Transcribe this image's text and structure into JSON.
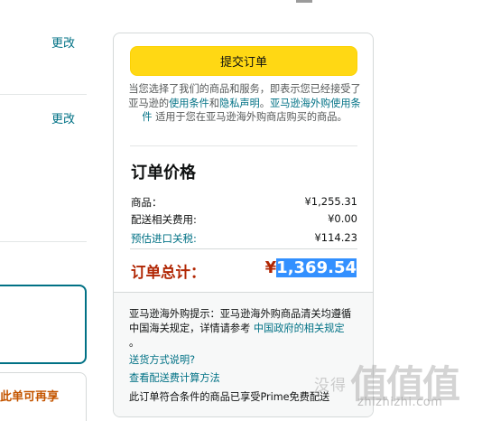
{
  "left": {
    "change_link_1": "更改",
    "change_link_2": "更改",
    "promo_text": "此单可再享"
  },
  "summary": {
    "place_order_button": "提交订单",
    "agreement": {
      "part1": "当您选择了我们的商品和服务，即表示您已经接受了亚马逊的",
      "link1": "使用条件",
      "and": "和",
      "link2": "隐私声明",
      "dot": "。",
      "link3": "亚马逊海外购使用条件",
      "part2": " 适用于您在亚马逊海外购商店购买的商品。"
    },
    "title": "订单价格",
    "rows": [
      {
        "label": "商品：",
        "value": "¥1,255.31"
      },
      {
        "label": "配送相关费用:",
        "value": "¥0.00"
      },
      {
        "label": "预估进口关税:",
        "value": "¥114.23"
      }
    ],
    "total_label": "订单总计：",
    "total_currency": "¥",
    "total_value": "1,369.54",
    "tip": {
      "part1": "亚马逊海外购提示：亚马逊海外购商品清关均遵循中国海关规定，详情请参考 ",
      "link": "中国政府的相关规定",
      "part2": " 。"
    },
    "delivery_link": "送货方式说明?",
    "shipping_link": "查看配送费计算方法",
    "prime_text": "此订单符合条件的商品已享受Prime免费配送"
  },
  "watermark": {
    "text": "没得",
    "glyphs": "值值值",
    "url": "zhizhizhi.com"
  },
  "colors": {
    "button_yellow": "#ffd814",
    "link_teal": "#007185",
    "price_red": "#b12704",
    "selection_blue": "#3390ff"
  }
}
